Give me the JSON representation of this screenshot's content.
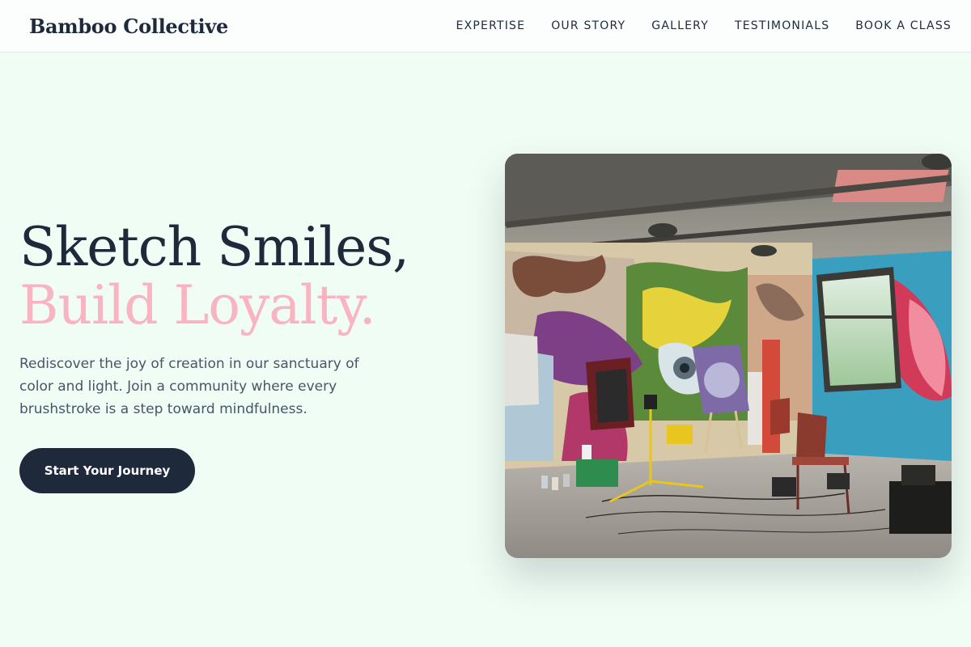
{
  "brand": {
    "name": "Bamboo Collective"
  },
  "nav": {
    "items": [
      {
        "label": "EXPERTISE"
      },
      {
        "label": "OUR STORY"
      },
      {
        "label": "GALLERY"
      },
      {
        "label": "TESTIMONIALS"
      },
      {
        "label": "BOOK A CLASS"
      }
    ]
  },
  "hero": {
    "title_line1": "Sketch Smiles,",
    "title_line2": "Build Loyalty.",
    "subtitle": "Rediscover the joy of creation in our sanctuary of color and light. Join a community where every brushstroke is a step toward mindfulness.",
    "cta_label": "Start Your Journey",
    "image_subject": "graffiti-art-studio-photo"
  },
  "colors": {
    "background": "#f0fdf4",
    "primary_text": "#1e293b",
    "accent_pink": "#f9b4c1",
    "button_bg": "#1e293b"
  }
}
